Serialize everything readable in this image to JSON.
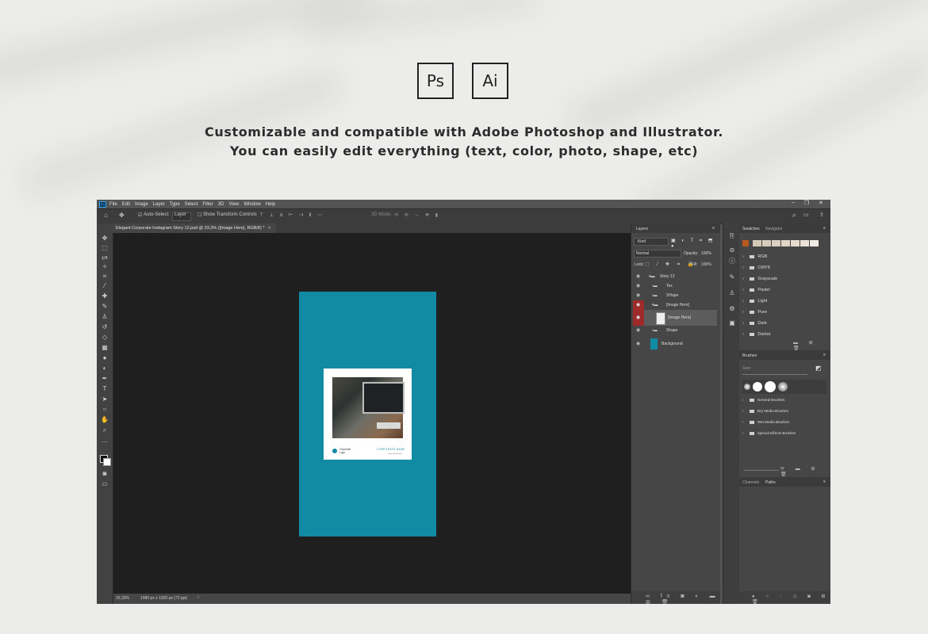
{
  "badges": {
    "ps": "Ps",
    "ai": "Ai"
  },
  "headline": {
    "line1": "Customizable and compatible with Adobe Photoshop and Illustrator.",
    "line2": "You can easily edit everything (text, color, photo, shape, etc)"
  },
  "photoshop": {
    "menu": [
      "File",
      "Edit",
      "Image",
      "Layer",
      "Type",
      "Select",
      "Filter",
      "3D",
      "View",
      "Window",
      "Help"
    ],
    "options": {
      "auto_select": "Auto-Select:",
      "layer": "Layer",
      "transform": "Show Transform Controls",
      "mode_3d": "3D Mode:"
    },
    "document_tab": "Elegant Corporate Instagram Story 12.psd @ 33,3% ([Image Here], RGB/8) *",
    "status": {
      "zoom": "33,33%",
      "size": "1080 px x 1920 px (72 ppi)"
    },
    "card": {
      "logo": "Corporate Logo",
      "name": "CORPORATE NAME"
    },
    "layers_panel": {
      "title": "Layers",
      "kind": "Kind",
      "blend": "Normal",
      "opacity_label": "Opacity:",
      "opacity": "100%",
      "lock_label": "Lock:",
      "fill_label": "Fill:",
      "fill": "100%",
      "rows": [
        "Story 12",
        "Tex",
        "SHape",
        "[Image Here]",
        "[Image Here]",
        "Shape",
        "Background"
      ]
    },
    "swatches_panel": {
      "tab1": "Swatches",
      "tab2": "Navigator",
      "groups": [
        "RGB",
        "CMYK",
        "Grayscale",
        "Pastel",
        "Light",
        "Pure",
        "Dark",
        "Darker"
      ],
      "colors": [
        "#b8581f",
        "#d6c8b6",
        "#d9cbb9",
        "#ddd0c0",
        "#e1d5c6",
        "#e6dccf",
        "#ebe3d9",
        "#f0eae3"
      ]
    },
    "brushes_panel": {
      "title": "Brushes",
      "size_label": "Size:",
      "groups": [
        "General Brushes",
        "Dry Media Brushes",
        "Wet Media Brushes",
        "Special Effects Brushes"
      ]
    },
    "bottom_panel": {
      "tab1": "Channels",
      "tab2": "Paths"
    }
  }
}
